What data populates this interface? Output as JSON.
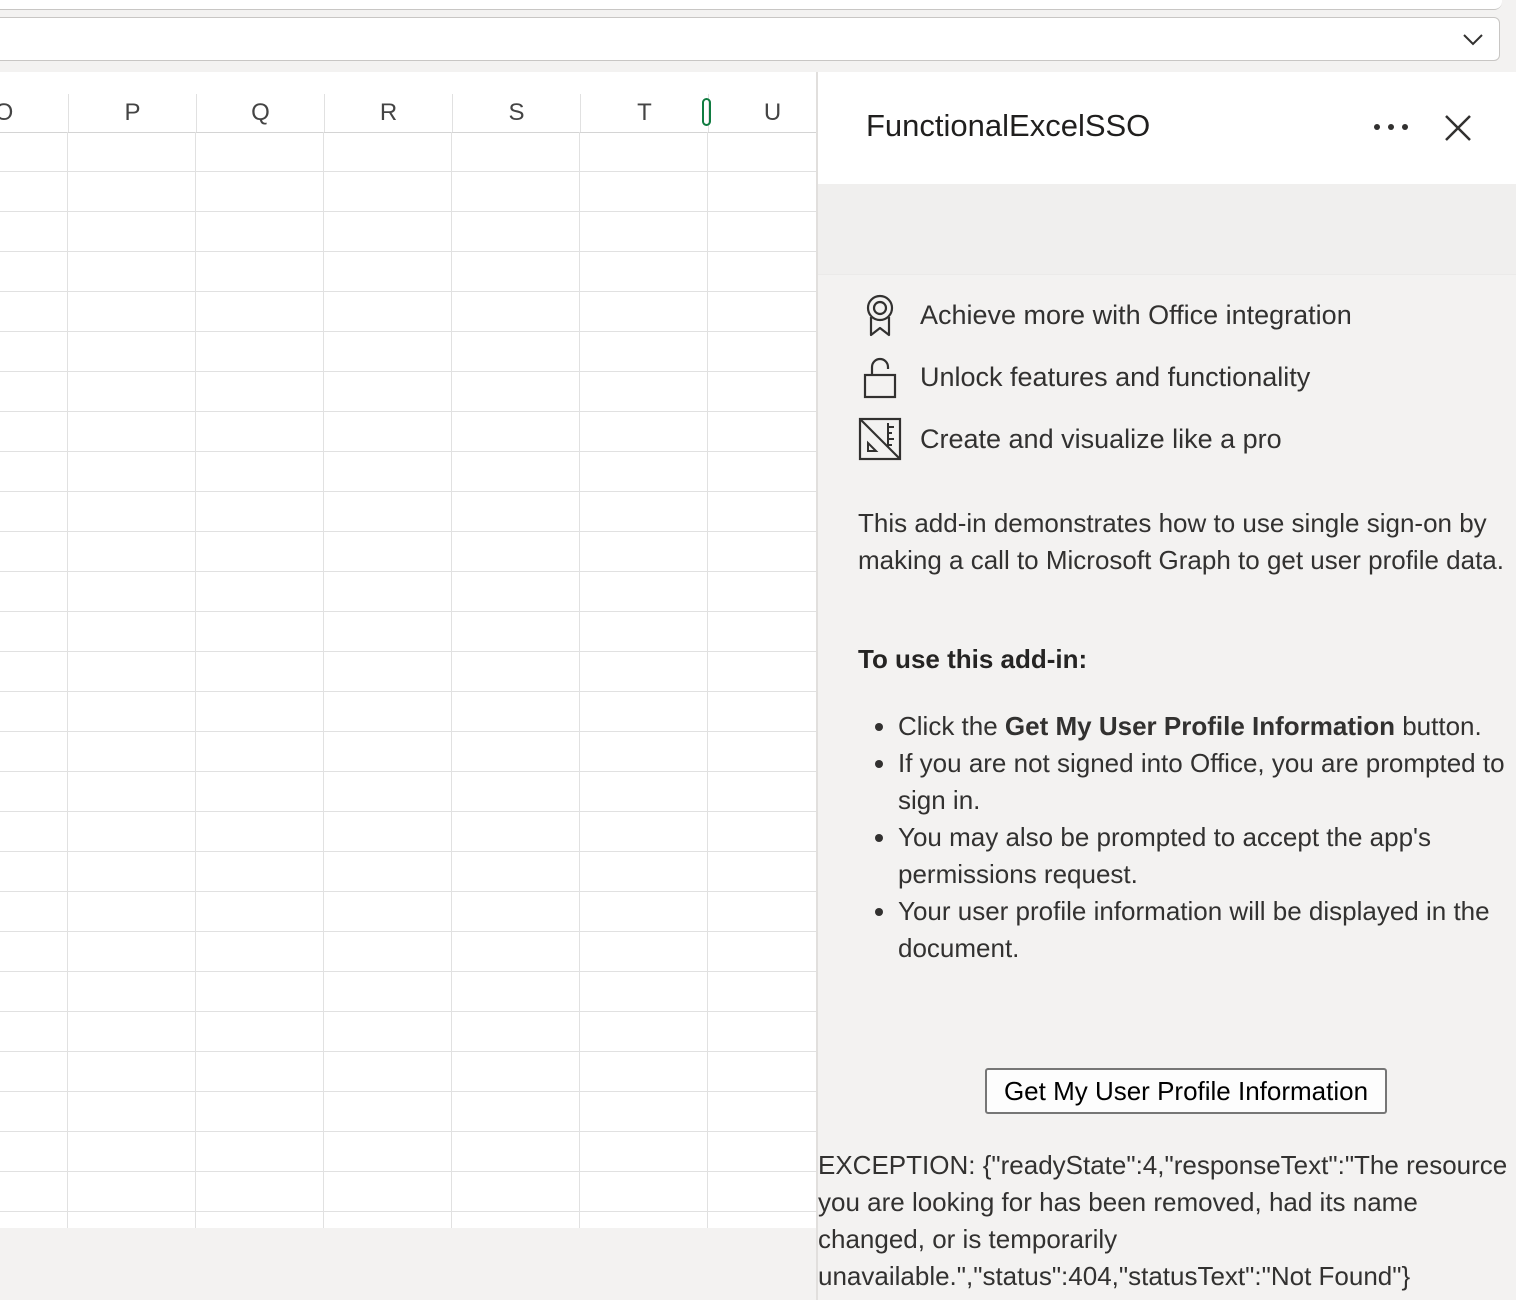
{
  "grid": {
    "columns": [
      "O",
      "P",
      "Q",
      "R",
      "S",
      "T",
      "U"
    ]
  },
  "pane": {
    "title": "FunctionalExcelSSO",
    "features": [
      {
        "icon": "ribbon-award-icon",
        "label": "Achieve more with Office integration"
      },
      {
        "icon": "unlock-icon",
        "label": "Unlock features and functionality"
      },
      {
        "icon": "design-ideas-icon",
        "label": "Create and visualize like a pro"
      }
    ],
    "description": "This add-in demonstrates how to use single sign-on by making a call to Microsoft Graph to get user profile data.",
    "howto_title": "To use this add-in:",
    "steps": {
      "step1_prefix": "Click the ",
      "step1_bold": "Get My User Profile Information",
      "step1_suffix": " button.",
      "step2": "If you are not signed into Office, you are prompted to sign in.",
      "step3": "You may also be prompted to accept the app's permissions request.",
      "step4": "Your user profile information will be displayed in the document."
    },
    "button_label": "Get My User Profile Information",
    "exception_text": "EXCEPTION: {\"readyState\":4,\"responseText\":\"The resource you are looking for has been removed, had its name changed, or is temporarily unavailable.\",\"status\":404,\"statusText\":\"Not Found\"}"
  },
  "colors": {
    "selection_accent": "#107c41",
    "pane_background": "#f3f2f1"
  }
}
